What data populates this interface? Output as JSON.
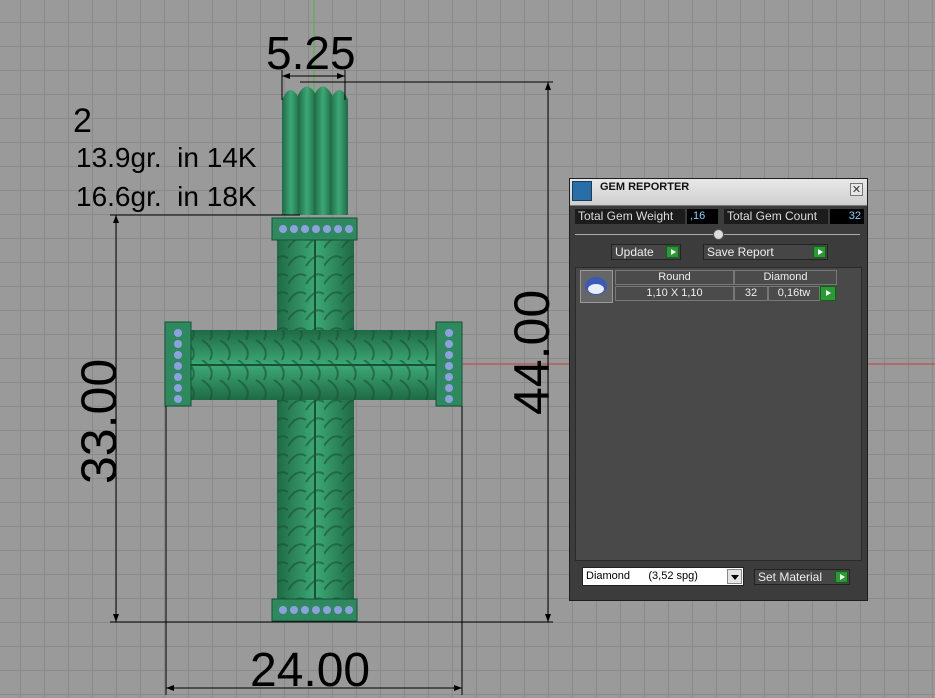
{
  "viewport": {
    "dims": {
      "top_width": "5.25",
      "height_total": "44.00",
      "height_body": "33.00",
      "width_arms": "24.00"
    },
    "annotation": {
      "count": "2",
      "weight_14k": "13.9gr.  in 14K",
      "weight_18k": "16.6gr.  in 18K"
    },
    "colors": {
      "metal": "#2e8a5e",
      "gem": "#8ea0e0",
      "background": "#9a9a9a"
    }
  },
  "gem_reporter": {
    "title": "GEM REPORTER",
    "close_icon": "close-icon",
    "total_weight_label": "Total Gem Weight",
    "total_weight_value": ",16",
    "total_count_label": "Total Gem Count",
    "total_count_value": "32",
    "update_label": "Update",
    "save_report_label": "Save Report",
    "table": {
      "header_shape": "Round",
      "header_material": "Diamond",
      "size": "1,10 X 1,10",
      "count": "32",
      "weight": "0,16tw"
    },
    "material_selected": "Diamond      (3,52 spg)",
    "set_material_label": "Set Material"
  }
}
